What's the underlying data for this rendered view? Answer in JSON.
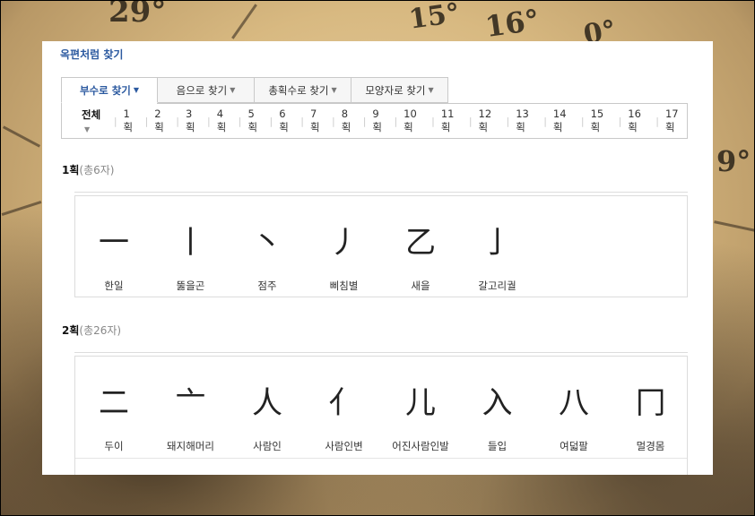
{
  "background": {
    "degrees": [
      "29°",
      "15°",
      "16°",
      "0°",
      "9°"
    ]
  },
  "title": "옥편처럼 찾기",
  "tabs": [
    {
      "label": "부수로 찾기",
      "active": true
    },
    {
      "label": "음으로 찾기",
      "active": false
    },
    {
      "label": "총획수로 찾기",
      "active": false
    },
    {
      "label": "모양자로 찾기",
      "active": false
    }
  ],
  "strokes": {
    "all_label": "전체",
    "items": [
      "1획",
      "2획",
      "3획",
      "4획",
      "5획",
      "6획",
      "7획",
      "8획",
      "9획",
      "10획",
      "11획",
      "12획",
      "13획",
      "14획",
      "15획",
      "16획",
      "17획"
    ]
  },
  "sections": [
    {
      "stroke": "1획",
      "count": "(총6자)",
      "chars": [
        {
          "glyph": "一",
          "name": "한일"
        },
        {
          "glyph": "丨",
          "name": "뚫을곤"
        },
        {
          "glyph": "丶",
          "name": "점주"
        },
        {
          "glyph": "丿",
          "name": "삐침별"
        },
        {
          "glyph": "乙",
          "name": "새을"
        },
        {
          "glyph": "亅",
          "name": "갈고리궐"
        }
      ]
    },
    {
      "stroke": "2획",
      "count": "(총26자)",
      "chars": [
        {
          "glyph": "二",
          "name": "두이"
        },
        {
          "glyph": "亠",
          "name": "돼지해머리"
        },
        {
          "glyph": "人",
          "name": "사람인"
        },
        {
          "glyph": "亻",
          "name": "사람인변"
        },
        {
          "glyph": "儿",
          "name": "어진사람인발"
        },
        {
          "glyph": "入",
          "name": "들입"
        },
        {
          "glyph": "八",
          "name": "여덟팔"
        },
        {
          "glyph": "冂",
          "name": "멀경몸"
        }
      ]
    }
  ]
}
